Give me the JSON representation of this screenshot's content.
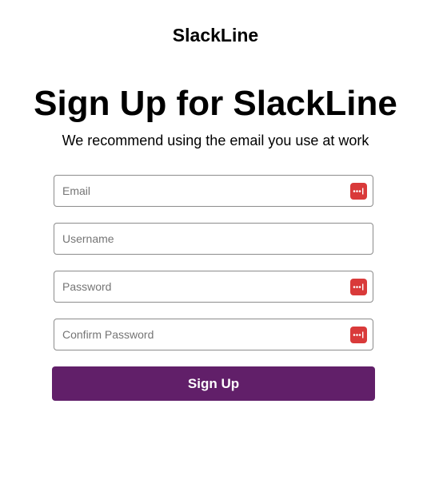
{
  "brand": {
    "name": "SlackLine"
  },
  "header": {
    "title": "Sign Up for SlackLine",
    "subtitle": "We recommend using the email you use at work"
  },
  "form": {
    "email": {
      "placeholder": "Email",
      "value": ""
    },
    "username": {
      "placeholder": "Username",
      "value": ""
    },
    "password": {
      "placeholder": "Password",
      "value": ""
    },
    "confirm_password": {
      "placeholder": "Confirm Password",
      "value": ""
    },
    "submit_label": "Sign Up"
  },
  "icons": {
    "password_manager": "password-manager-icon"
  },
  "colors": {
    "brand_purple": "#611f69",
    "password_manager_red": "#d93a3a",
    "field_border": "#8c8c8c"
  }
}
